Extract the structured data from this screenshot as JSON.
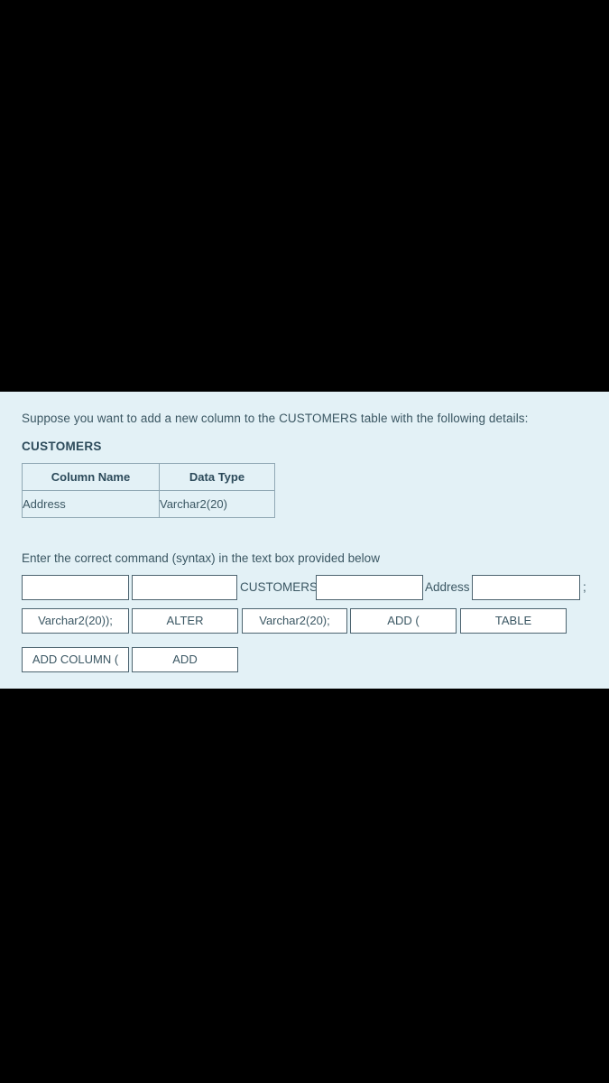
{
  "panel": {
    "background_color": "#e3f1f6",
    "text_color": "#3b5763"
  },
  "prompt": "Suppose you want to add a new column to the CUSTOMERS table with the following details:",
  "table": {
    "title": "CUSTOMERS",
    "headers": [
      "Column Name",
      "Data Type"
    ],
    "rows": [
      [
        "Address",
        "Varchar2(20)"
      ]
    ]
  },
  "instruction": "Enter the correct command (syntax) in the text box provided below",
  "answer_row": {
    "blank_1": {
      "value": "",
      "placeholder": ""
    },
    "blank_2": {
      "value": "",
      "placeholder": ""
    },
    "word_customers": "CUSTOMERS",
    "blank_3": {
      "value": "",
      "placeholder": ""
    },
    "word_address": "Address",
    "blank_4": {
      "value": "",
      "placeholder": ""
    },
    "terminator": ";"
  },
  "word_bank": [
    {
      "label": "Varchar2(20));",
      "row": 1
    },
    {
      "label": "ALTER",
      "row": 1
    },
    {
      "label": "Varchar2(20);",
      "row": 1
    },
    {
      "label": "ADD (",
      "row": 1
    },
    {
      "label": "TABLE",
      "row": 1
    },
    {
      "label": "ADD COLUMN (",
      "row": 2
    },
    {
      "label": "ADD",
      "row": 2
    }
  ]
}
